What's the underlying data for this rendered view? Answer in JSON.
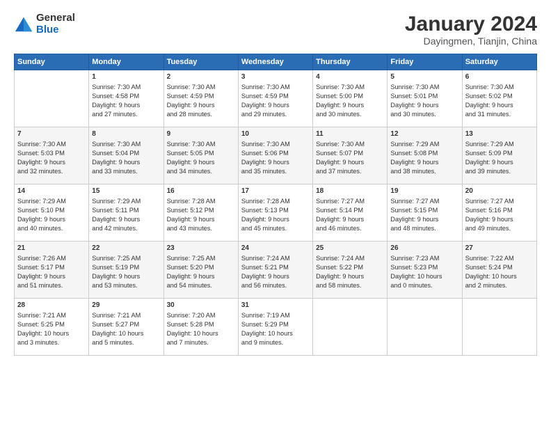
{
  "logo": {
    "general": "General",
    "blue": "Blue"
  },
  "title": "January 2024",
  "subtitle": "Dayingmen, Tianjin, China",
  "headers": [
    "Sunday",
    "Monday",
    "Tuesday",
    "Wednesday",
    "Thursday",
    "Friday",
    "Saturday"
  ],
  "weeks": [
    [
      {
        "day": "",
        "lines": []
      },
      {
        "day": "1",
        "lines": [
          "Sunrise: 7:30 AM",
          "Sunset: 4:58 PM",
          "Daylight: 9 hours",
          "and 27 minutes."
        ]
      },
      {
        "day": "2",
        "lines": [
          "Sunrise: 7:30 AM",
          "Sunset: 4:59 PM",
          "Daylight: 9 hours",
          "and 28 minutes."
        ]
      },
      {
        "day": "3",
        "lines": [
          "Sunrise: 7:30 AM",
          "Sunset: 4:59 PM",
          "Daylight: 9 hours",
          "and 29 minutes."
        ]
      },
      {
        "day": "4",
        "lines": [
          "Sunrise: 7:30 AM",
          "Sunset: 5:00 PM",
          "Daylight: 9 hours",
          "and 30 minutes."
        ]
      },
      {
        "day": "5",
        "lines": [
          "Sunrise: 7:30 AM",
          "Sunset: 5:01 PM",
          "Daylight: 9 hours",
          "and 30 minutes."
        ]
      },
      {
        "day": "6",
        "lines": [
          "Sunrise: 7:30 AM",
          "Sunset: 5:02 PM",
          "Daylight: 9 hours",
          "and 31 minutes."
        ]
      }
    ],
    [
      {
        "day": "7",
        "lines": [
          "Sunrise: 7:30 AM",
          "Sunset: 5:03 PM",
          "Daylight: 9 hours",
          "and 32 minutes."
        ]
      },
      {
        "day": "8",
        "lines": [
          "Sunrise: 7:30 AM",
          "Sunset: 5:04 PM",
          "Daylight: 9 hours",
          "and 33 minutes."
        ]
      },
      {
        "day": "9",
        "lines": [
          "Sunrise: 7:30 AM",
          "Sunset: 5:05 PM",
          "Daylight: 9 hours",
          "and 34 minutes."
        ]
      },
      {
        "day": "10",
        "lines": [
          "Sunrise: 7:30 AM",
          "Sunset: 5:06 PM",
          "Daylight: 9 hours",
          "and 35 minutes."
        ]
      },
      {
        "day": "11",
        "lines": [
          "Sunrise: 7:30 AM",
          "Sunset: 5:07 PM",
          "Daylight: 9 hours",
          "and 37 minutes."
        ]
      },
      {
        "day": "12",
        "lines": [
          "Sunrise: 7:29 AM",
          "Sunset: 5:08 PM",
          "Daylight: 9 hours",
          "and 38 minutes."
        ]
      },
      {
        "day": "13",
        "lines": [
          "Sunrise: 7:29 AM",
          "Sunset: 5:09 PM",
          "Daylight: 9 hours",
          "and 39 minutes."
        ]
      }
    ],
    [
      {
        "day": "14",
        "lines": [
          "Sunrise: 7:29 AM",
          "Sunset: 5:10 PM",
          "Daylight: 9 hours",
          "and 40 minutes."
        ]
      },
      {
        "day": "15",
        "lines": [
          "Sunrise: 7:29 AM",
          "Sunset: 5:11 PM",
          "Daylight: 9 hours",
          "and 42 minutes."
        ]
      },
      {
        "day": "16",
        "lines": [
          "Sunrise: 7:28 AM",
          "Sunset: 5:12 PM",
          "Daylight: 9 hours",
          "and 43 minutes."
        ]
      },
      {
        "day": "17",
        "lines": [
          "Sunrise: 7:28 AM",
          "Sunset: 5:13 PM",
          "Daylight: 9 hours",
          "and 45 minutes."
        ]
      },
      {
        "day": "18",
        "lines": [
          "Sunrise: 7:27 AM",
          "Sunset: 5:14 PM",
          "Daylight: 9 hours",
          "and 46 minutes."
        ]
      },
      {
        "day": "19",
        "lines": [
          "Sunrise: 7:27 AM",
          "Sunset: 5:15 PM",
          "Daylight: 9 hours",
          "and 48 minutes."
        ]
      },
      {
        "day": "20",
        "lines": [
          "Sunrise: 7:27 AM",
          "Sunset: 5:16 PM",
          "Daylight: 9 hours",
          "and 49 minutes."
        ]
      }
    ],
    [
      {
        "day": "21",
        "lines": [
          "Sunrise: 7:26 AM",
          "Sunset: 5:17 PM",
          "Daylight: 9 hours",
          "and 51 minutes."
        ]
      },
      {
        "day": "22",
        "lines": [
          "Sunrise: 7:25 AM",
          "Sunset: 5:19 PM",
          "Daylight: 9 hours",
          "and 53 minutes."
        ]
      },
      {
        "day": "23",
        "lines": [
          "Sunrise: 7:25 AM",
          "Sunset: 5:20 PM",
          "Daylight: 9 hours",
          "and 54 minutes."
        ]
      },
      {
        "day": "24",
        "lines": [
          "Sunrise: 7:24 AM",
          "Sunset: 5:21 PM",
          "Daylight: 9 hours",
          "and 56 minutes."
        ]
      },
      {
        "day": "25",
        "lines": [
          "Sunrise: 7:24 AM",
          "Sunset: 5:22 PM",
          "Daylight: 9 hours",
          "and 58 minutes."
        ]
      },
      {
        "day": "26",
        "lines": [
          "Sunrise: 7:23 AM",
          "Sunset: 5:23 PM",
          "Daylight: 10 hours",
          "and 0 minutes."
        ]
      },
      {
        "day": "27",
        "lines": [
          "Sunrise: 7:22 AM",
          "Sunset: 5:24 PM",
          "Daylight: 10 hours",
          "and 2 minutes."
        ]
      }
    ],
    [
      {
        "day": "28",
        "lines": [
          "Sunrise: 7:21 AM",
          "Sunset: 5:25 PM",
          "Daylight: 10 hours",
          "and 3 minutes."
        ]
      },
      {
        "day": "29",
        "lines": [
          "Sunrise: 7:21 AM",
          "Sunset: 5:27 PM",
          "Daylight: 10 hours",
          "and 5 minutes."
        ]
      },
      {
        "day": "30",
        "lines": [
          "Sunrise: 7:20 AM",
          "Sunset: 5:28 PM",
          "Daylight: 10 hours",
          "and 7 minutes."
        ]
      },
      {
        "day": "31",
        "lines": [
          "Sunrise: 7:19 AM",
          "Sunset: 5:29 PM",
          "Daylight: 10 hours",
          "and 9 minutes."
        ]
      },
      {
        "day": "",
        "lines": []
      },
      {
        "day": "",
        "lines": []
      },
      {
        "day": "",
        "lines": []
      }
    ]
  ]
}
